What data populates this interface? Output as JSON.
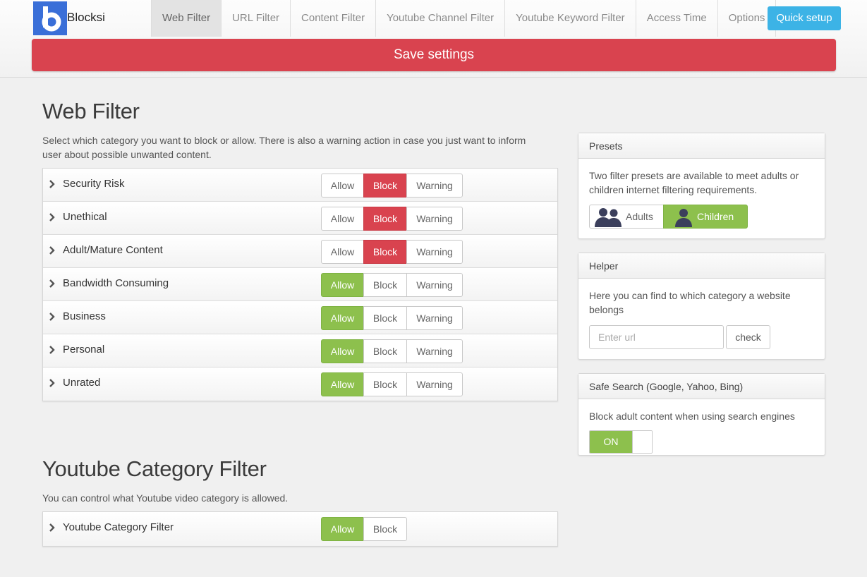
{
  "app": {
    "brand": "Blocksi",
    "logo_icon": "blocksi-b-logo"
  },
  "nav": {
    "tabs": [
      {
        "label": "Web Filter",
        "active": true
      },
      {
        "label": "URL Filter"
      },
      {
        "label": "Content Filter"
      },
      {
        "label": "Youtube Channel Filter"
      },
      {
        "label": "Youtube Keyword Filter"
      },
      {
        "label": "Access Time"
      },
      {
        "label": "Options"
      }
    ],
    "quick_setup": "Quick setup",
    "save_settings": "Save settings"
  },
  "web_filter": {
    "title": "Web Filter",
    "description_line1": "Select which category you want to block or allow. There is also a warning action in case you just want to inform",
    "description_line2": "user about possible unwanted content.",
    "options": {
      "allow": "Allow",
      "block": "Block",
      "warning": "Warning"
    },
    "categories": [
      {
        "label": "Security Risk",
        "selected": "block"
      },
      {
        "label": "Unethical",
        "selected": "block"
      },
      {
        "label": "Adult/Mature Content",
        "selected": "block"
      },
      {
        "label": "Bandwidth Consuming",
        "selected": "allow"
      },
      {
        "label": "Business",
        "selected": "allow"
      },
      {
        "label": "Personal",
        "selected": "allow"
      },
      {
        "label": "Unrated",
        "selected": "allow"
      }
    ]
  },
  "youtube_filter": {
    "title": "Youtube Category Filter",
    "description": "You can control what Youtube video category is allowed.",
    "options": {
      "allow": "Allow",
      "block": "Block"
    },
    "categories": [
      {
        "label": "Youtube Category Filter",
        "selected": "allow"
      }
    ]
  },
  "presets": {
    "title": "Presets",
    "description": "Two filter presets are available to meet adults or children internet filtering requirements.",
    "adults": "Adults",
    "children": "Children",
    "selected": "children"
  },
  "helper": {
    "title": "Helper",
    "description": "Here you can find to which category a website belongs",
    "url_placeholder": "Enter url",
    "check": "check"
  },
  "safe_search": {
    "title": "Safe Search (Google, Yahoo, Bing)",
    "description": "Block adult content when using search engines",
    "toggle_label": "ON",
    "enabled": true
  },
  "colors": {
    "save_red": "#d9434f",
    "allow_green": "#8dc04d",
    "quick_setup_blue": "#3cb3e6",
    "logo_blue": "#3a6fd8"
  }
}
